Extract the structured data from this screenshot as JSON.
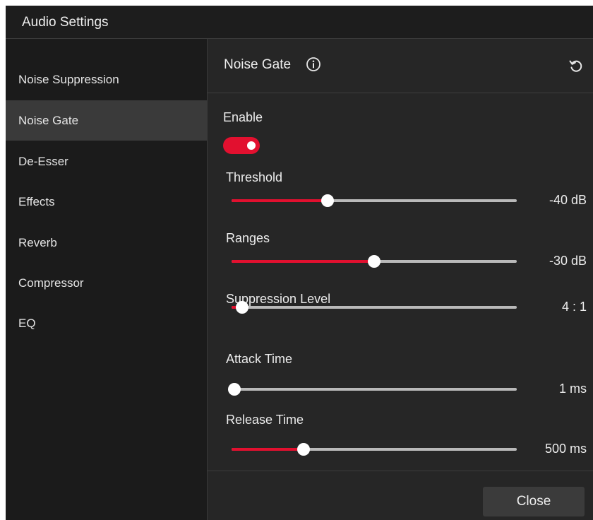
{
  "window": {
    "title": "Audio Settings"
  },
  "sidebar": {
    "items": [
      {
        "label": "Noise Suppression",
        "active": false
      },
      {
        "label": "Noise Gate",
        "active": true
      },
      {
        "label": "De-Esser",
        "active": false
      },
      {
        "label": "Effects",
        "active": false
      },
      {
        "label": "Reverb",
        "active": false
      },
      {
        "label": "Compressor",
        "active": false
      },
      {
        "label": "EQ",
        "active": false
      }
    ]
  },
  "panel": {
    "title": "Noise Gate",
    "info_icon": "info-icon",
    "reset_icon": "reset-icon",
    "enable": {
      "label": "Enable",
      "on": true
    },
    "sliders": [
      {
        "label": "Threshold",
        "value_text": "-40 dB",
        "fraction": 0.336
      },
      {
        "label": "Ranges",
        "value_text": "-30 dB",
        "fraction": 0.5
      },
      {
        "label": "Suppression Level",
        "value_text": "4 : 1",
        "fraction": 0.037
      },
      {
        "label": "Attack Time",
        "value_text": "1 ms",
        "fraction": 0.01
      },
      {
        "label": "Release Time",
        "value_text": "500 ms",
        "fraction": 0.253
      }
    ]
  },
  "footer": {
    "close_label": "Close"
  },
  "colors": {
    "accent": "#e2102f",
    "track": "#b9b9b9",
    "sidebar_active": "#3a3a3a",
    "background": "#262626"
  }
}
